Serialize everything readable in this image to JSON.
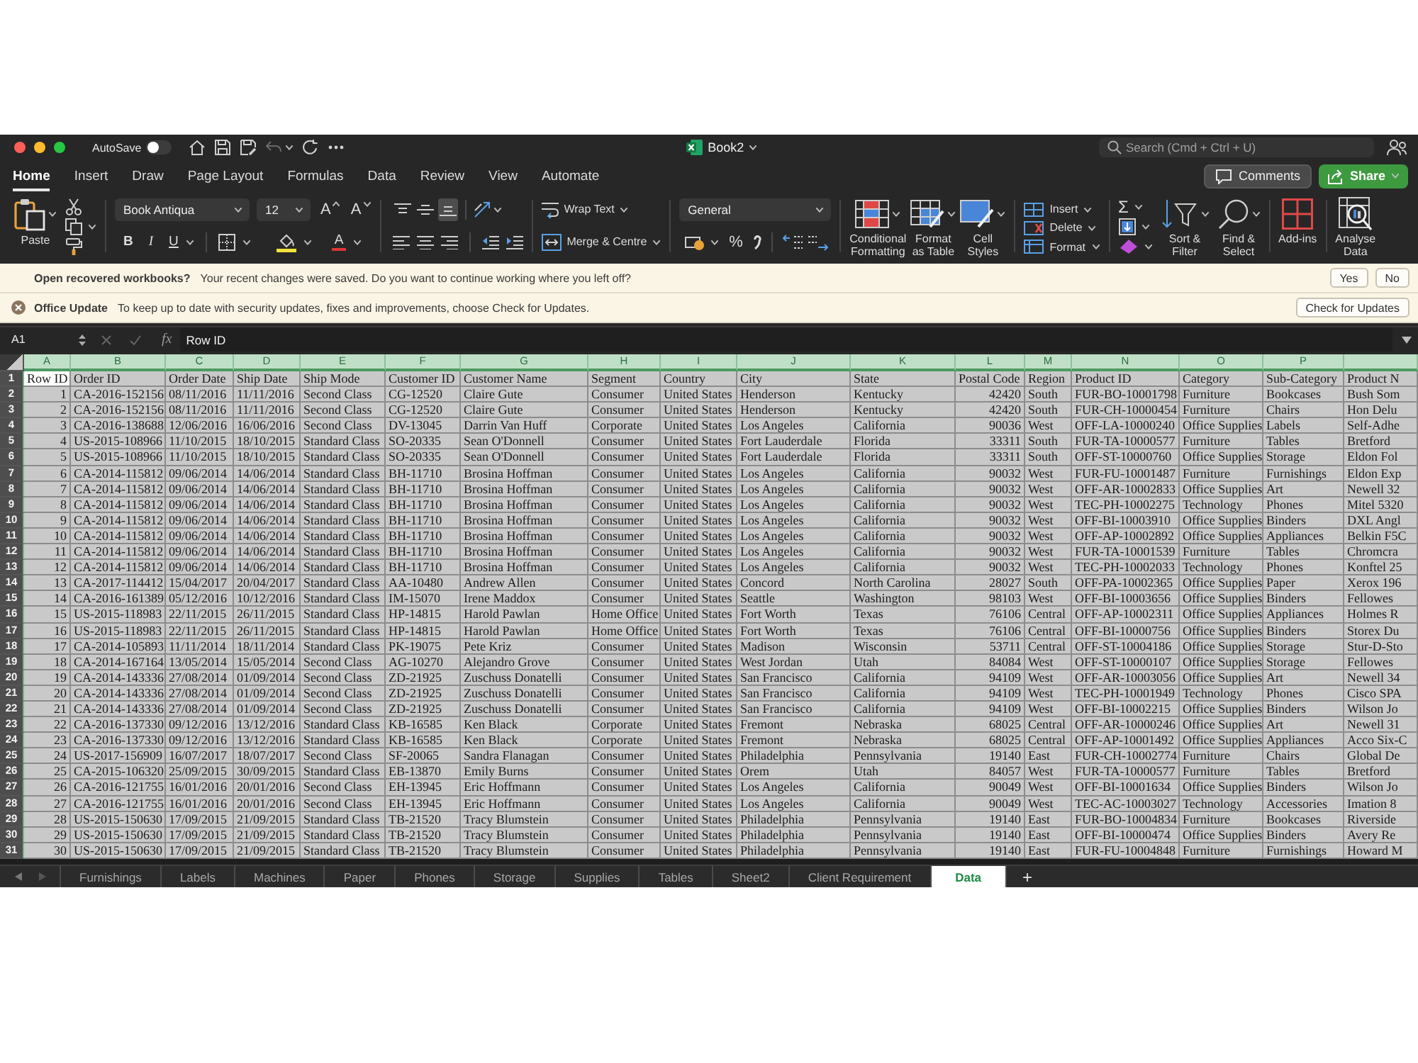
{
  "window": {
    "title": "Book2",
    "autosave": {
      "label": "AutoSave",
      "on": false
    },
    "search": {
      "placeholder": "Search (Cmd + Ctrl + U)"
    }
  },
  "ribbon_tabs": [
    {
      "label": "Home",
      "selected": true
    },
    {
      "label": "Insert",
      "selected": false
    },
    {
      "label": "Draw",
      "selected": false
    },
    {
      "label": "Page Layout",
      "selected": false
    },
    {
      "label": "Formulas",
      "selected": false
    },
    {
      "label": "Data",
      "selected": false
    },
    {
      "label": "Review",
      "selected": false
    },
    {
      "label": "View",
      "selected": false
    },
    {
      "label": "Automate",
      "selected": false
    }
  ],
  "actions": {
    "comments": "Comments",
    "share": "Share"
  },
  "ribbon": {
    "paste": "Paste",
    "font_name": "Book Antiqua",
    "font_size": "12",
    "grow_font": "A",
    "shrink_font": "A",
    "bold": "B",
    "italic": "I",
    "underline": "U",
    "font_color": "A",
    "vertical_align": [
      {
        "selected": false
      },
      {
        "selected": false
      },
      {
        "selected": true
      }
    ],
    "wrap_text": "Wrap Text",
    "merge": "Merge & Centre",
    "number_format": "General",
    "percent": "%",
    "styles": [
      "Conditional\nFormatting",
      "Format\nas Table",
      "Cell\nStyles"
    ],
    "cells": [
      "Insert",
      "Delete",
      "Format"
    ],
    "autosum": "Σ",
    "editing": [
      "Sort &\nFilter",
      "Find &\nSelect"
    ],
    "add_ins": "Add-ins",
    "analyse": "Analyse\nData"
  },
  "notices": [
    {
      "kind": "recovery",
      "title": "Open recovered workbooks?",
      "message": "Your recent changes were saved. Do you want to continue working where you left off?",
      "buttons": [
        "Yes",
        "No"
      ]
    },
    {
      "kind": "update",
      "title": "Office Update",
      "message": "To keep up to date with security updates, fixes and improvements, choose Check for Updates.",
      "buttons": [
        "Check for Updates"
      ]
    }
  ],
  "formula_bar": {
    "name_box": "A1",
    "fx": "fx",
    "formula": "Row ID"
  },
  "sheet": {
    "all_selected": true,
    "columns": [
      {
        "letter": "A",
        "numeric": true
      },
      {
        "letter": "B",
        "numeric": false
      },
      {
        "letter": "C",
        "numeric": false
      },
      {
        "letter": "D",
        "numeric": false
      },
      {
        "letter": "E",
        "numeric": false
      },
      {
        "letter": "F",
        "numeric": false
      },
      {
        "letter": "G",
        "numeric": false
      },
      {
        "letter": "H",
        "numeric": false
      },
      {
        "letter": "I",
        "numeric": false
      },
      {
        "letter": "J",
        "numeric": false
      },
      {
        "letter": "K",
        "numeric": false
      },
      {
        "letter": "L",
        "numeric": true
      },
      {
        "letter": "M",
        "numeric": false
      },
      {
        "letter": "N",
        "numeric": false
      },
      {
        "letter": "O",
        "numeric": false
      },
      {
        "letter": "P",
        "numeric": false
      },
      {
        "numeric": false
      }
    ],
    "header_row": {
      "number": "1",
      "cells": [
        {
          "text": "Row ID",
          "active": true
        },
        {
          "text": "Order ID",
          "active": false
        },
        {
          "text": "Order Date",
          "active": false
        },
        {
          "text": "Ship Date",
          "active": false
        },
        {
          "text": "Ship Mode",
          "active": false
        },
        {
          "text": "Customer ID",
          "active": false
        },
        {
          "text": "Customer Name",
          "active": false
        },
        {
          "text": "Segment",
          "active": false
        },
        {
          "text": "Country",
          "active": false
        },
        {
          "text": "City",
          "active": false
        },
        {
          "text": "State",
          "active": false
        },
        {
          "text": "Postal Code",
          "active": false
        },
        {
          "text": "Region",
          "active": false
        },
        {
          "text": "Product ID",
          "active": false
        },
        {
          "text": "Category",
          "active": false
        },
        {
          "text": "Sub-Category",
          "active": false
        },
        {
          "text": "Product N",
          "active": false
        }
      ]
    },
    "rows": [
      {
        "number": "2",
        "cells": [
          "1",
          "CA-2016-152156",
          "08/11/2016",
          "11/11/2016",
          "Second Class",
          "CG-12520",
          "Claire Gute",
          "Consumer",
          "United States",
          "Henderson",
          "Kentucky",
          "42420",
          "South",
          "FUR-BO-10001798",
          "Furniture",
          "Bookcases",
          "Bush Som"
        ]
      },
      {
        "number": "3",
        "cells": [
          "2",
          "CA-2016-152156",
          "08/11/2016",
          "11/11/2016",
          "Second Class",
          "CG-12520",
          "Claire Gute",
          "Consumer",
          "United States",
          "Henderson",
          "Kentucky",
          "42420",
          "South",
          "FUR-CH-10000454",
          "Furniture",
          "Chairs",
          "Hon Delu"
        ]
      },
      {
        "number": "4",
        "cells": [
          "3",
          "CA-2016-138688",
          "12/06/2016",
          "16/06/2016",
          "Second Class",
          "DV-13045",
          "Darrin Van Huff",
          "Corporate",
          "United States",
          "Los Angeles",
          "California",
          "90036",
          "West",
          "OFF-LA-10000240",
          "Office Supplies",
          "Labels",
          "Self-Adhe"
        ]
      },
      {
        "number": "5",
        "cells": [
          "4",
          "US-2015-108966",
          "11/10/2015",
          "18/10/2015",
          "Standard Class",
          "SO-20335",
          "Sean O'Donnell",
          "Consumer",
          "United States",
          "Fort Lauderdale",
          "Florida",
          "33311",
          "South",
          "FUR-TA-10000577",
          "Furniture",
          "Tables",
          "Bretford"
        ]
      },
      {
        "number": "6",
        "cells": [
          "5",
          "US-2015-108966",
          "11/10/2015",
          "18/10/2015",
          "Standard Class",
          "SO-20335",
          "Sean O'Donnell",
          "Consumer",
          "United States",
          "Fort Lauderdale",
          "Florida",
          "33311",
          "South",
          "OFF-ST-10000760",
          "Office Supplies",
          "Storage",
          "Eldon Fol"
        ]
      },
      {
        "number": "7",
        "cells": [
          "6",
          "CA-2014-115812",
          "09/06/2014",
          "14/06/2014",
          "Standard Class",
          "BH-11710",
          "Brosina Hoffman",
          "Consumer",
          "United States",
          "Los Angeles",
          "California",
          "90032",
          "West",
          "FUR-FU-10001487",
          "Furniture",
          "Furnishings",
          "Eldon Exp"
        ]
      },
      {
        "number": "8",
        "cells": [
          "7",
          "CA-2014-115812",
          "09/06/2014",
          "14/06/2014",
          "Standard Class",
          "BH-11710",
          "Brosina Hoffman",
          "Consumer",
          "United States",
          "Los Angeles",
          "California",
          "90032",
          "West",
          "OFF-AR-10002833",
          "Office Supplies",
          "Art",
          "Newell 32"
        ]
      },
      {
        "number": "9",
        "cells": [
          "8",
          "CA-2014-115812",
          "09/06/2014",
          "14/06/2014",
          "Standard Class",
          "BH-11710",
          "Brosina Hoffman",
          "Consumer",
          "United States",
          "Los Angeles",
          "California",
          "90032",
          "West",
          "TEC-PH-10002275",
          "Technology",
          "Phones",
          "Mitel 5320"
        ]
      },
      {
        "number": "10",
        "cells": [
          "9",
          "CA-2014-115812",
          "09/06/2014",
          "14/06/2014",
          "Standard Class",
          "BH-11710",
          "Brosina Hoffman",
          "Consumer",
          "United States",
          "Los Angeles",
          "California",
          "90032",
          "West",
          "OFF-BI-10003910",
          "Office Supplies",
          "Binders",
          "DXL Angl"
        ]
      },
      {
        "number": "11",
        "cells": [
          "10",
          "CA-2014-115812",
          "09/06/2014",
          "14/06/2014",
          "Standard Class",
          "BH-11710",
          "Brosina Hoffman",
          "Consumer",
          "United States",
          "Los Angeles",
          "California",
          "90032",
          "West",
          "OFF-AP-10002892",
          "Office Supplies",
          "Appliances",
          "Belkin F5C"
        ]
      },
      {
        "number": "12",
        "cells": [
          "11",
          "CA-2014-115812",
          "09/06/2014",
          "14/06/2014",
          "Standard Class",
          "BH-11710",
          "Brosina Hoffman",
          "Consumer",
          "United States",
          "Los Angeles",
          "California",
          "90032",
          "West",
          "FUR-TA-10001539",
          "Furniture",
          "Tables",
          "Chromcra"
        ]
      },
      {
        "number": "13",
        "cells": [
          "12",
          "CA-2014-115812",
          "09/06/2014",
          "14/06/2014",
          "Standard Class",
          "BH-11710",
          "Brosina Hoffman",
          "Consumer",
          "United States",
          "Los Angeles",
          "California",
          "90032",
          "West",
          "TEC-PH-10002033",
          "Technology",
          "Phones",
          "Konftel 25"
        ]
      },
      {
        "number": "14",
        "cells": [
          "13",
          "CA-2017-114412",
          "15/04/2017",
          "20/04/2017",
          "Standard Class",
          "AA-10480",
          "Andrew Allen",
          "Consumer",
          "United States",
          "Concord",
          "North Carolina",
          "28027",
          "South",
          "OFF-PA-10002365",
          "Office Supplies",
          "Paper",
          "Xerox 196"
        ]
      },
      {
        "number": "15",
        "cells": [
          "14",
          "CA-2016-161389",
          "05/12/2016",
          "10/12/2016",
          "Standard Class",
          "IM-15070",
          "Irene Maddox",
          "Consumer",
          "United States",
          "Seattle",
          "Washington",
          "98103",
          "West",
          "OFF-BI-10003656",
          "Office Supplies",
          "Binders",
          "Fellowes"
        ]
      },
      {
        "number": "16",
        "cells": [
          "15",
          "US-2015-118983",
          "22/11/2015",
          "26/11/2015",
          "Standard Class",
          "HP-14815",
          "Harold Pawlan",
          "Home Office",
          "United States",
          "Fort Worth",
          "Texas",
          "76106",
          "Central",
          "OFF-AP-10002311",
          "Office Supplies",
          "Appliances",
          "Holmes R"
        ]
      },
      {
        "number": "17",
        "cells": [
          "16",
          "US-2015-118983",
          "22/11/2015",
          "26/11/2015",
          "Standard Class",
          "HP-14815",
          "Harold Pawlan",
          "Home Office",
          "United States",
          "Fort Worth",
          "Texas",
          "76106",
          "Central",
          "OFF-BI-10000756",
          "Office Supplies",
          "Binders",
          "Storex Du"
        ]
      },
      {
        "number": "18",
        "cells": [
          "17",
          "CA-2014-105893",
          "11/11/2014",
          "18/11/2014",
          "Standard Class",
          "PK-19075",
          "Pete Kriz",
          "Consumer",
          "United States",
          "Madison",
          "Wisconsin",
          "53711",
          "Central",
          "OFF-ST-10004186",
          "Office Supplies",
          "Storage",
          "Stur-D-Sto"
        ]
      },
      {
        "number": "19",
        "cells": [
          "18",
          "CA-2014-167164",
          "13/05/2014",
          "15/05/2014",
          "Second Class",
          "AG-10270",
          "Alejandro Grove",
          "Consumer",
          "United States",
          "West Jordan",
          "Utah",
          "84084",
          "West",
          "OFF-ST-10000107",
          "Office Supplies",
          "Storage",
          "Fellowes"
        ]
      },
      {
        "number": "20",
        "cells": [
          "19",
          "CA-2014-143336",
          "27/08/2014",
          "01/09/2014",
          "Second Class",
          "ZD-21925",
          "Zuschuss Donatelli",
          "Consumer",
          "United States",
          "San Francisco",
          "California",
          "94109",
          "West",
          "OFF-AR-10003056",
          "Office Supplies",
          "Art",
          "Newell 34"
        ]
      },
      {
        "number": "21",
        "cells": [
          "20",
          "CA-2014-143336",
          "27/08/2014",
          "01/09/2014",
          "Second Class",
          "ZD-21925",
          "Zuschuss Donatelli",
          "Consumer",
          "United States",
          "San Francisco",
          "California",
          "94109",
          "West",
          "TEC-PH-10001949",
          "Technology",
          "Phones",
          "Cisco SPA"
        ]
      },
      {
        "number": "22",
        "cells": [
          "21",
          "CA-2014-143336",
          "27/08/2014",
          "01/09/2014",
          "Second Class",
          "ZD-21925",
          "Zuschuss Donatelli",
          "Consumer",
          "United States",
          "San Francisco",
          "California",
          "94109",
          "West",
          "OFF-BI-10002215",
          "Office Supplies",
          "Binders",
          "Wilson Jo"
        ]
      },
      {
        "number": "23",
        "cells": [
          "22",
          "CA-2016-137330",
          "09/12/2016",
          "13/12/2016",
          "Standard Class",
          "KB-16585",
          "Ken Black",
          "Corporate",
          "United States",
          "Fremont",
          "Nebraska",
          "68025",
          "Central",
          "OFF-AR-10000246",
          "Office Supplies",
          "Art",
          "Newell 31"
        ]
      },
      {
        "number": "24",
        "cells": [
          "23",
          "CA-2016-137330",
          "09/12/2016",
          "13/12/2016",
          "Standard Class",
          "KB-16585",
          "Ken Black",
          "Corporate",
          "United States",
          "Fremont",
          "Nebraska",
          "68025",
          "Central",
          "OFF-AP-10001492",
          "Office Supplies",
          "Appliances",
          "Acco Six-C"
        ]
      },
      {
        "number": "25",
        "cells": [
          "24",
          "US-2017-156909",
          "16/07/2017",
          "18/07/2017",
          "Second Class",
          "SF-20065",
          "Sandra Flanagan",
          "Consumer",
          "United States",
          "Philadelphia",
          "Pennsylvania",
          "19140",
          "East",
          "FUR-CH-10002774",
          "Furniture",
          "Chairs",
          "Global De"
        ]
      },
      {
        "number": "26",
        "cells": [
          "25",
          "CA-2015-106320",
          "25/09/2015",
          "30/09/2015",
          "Standard Class",
          "EB-13870",
          "Emily Burns",
          "Consumer",
          "United States",
          "Orem",
          "Utah",
          "84057",
          "West",
          "FUR-TA-10000577",
          "Furniture",
          "Tables",
          "Bretford"
        ]
      },
      {
        "number": "27",
        "cells": [
          "26",
          "CA-2016-121755",
          "16/01/2016",
          "20/01/2016",
          "Second Class",
          "EH-13945",
          "Eric Hoffmann",
          "Consumer",
          "United States",
          "Los Angeles",
          "California",
          "90049",
          "West",
          "OFF-BI-10001634",
          "Office Supplies",
          "Binders",
          "Wilson Jo"
        ]
      },
      {
        "number": "28",
        "cells": [
          "27",
          "CA-2016-121755",
          "16/01/2016",
          "20/01/2016",
          "Second Class",
          "EH-13945",
          "Eric Hoffmann",
          "Consumer",
          "United States",
          "Los Angeles",
          "California",
          "90049",
          "West",
          "TEC-AC-10003027",
          "Technology",
          "Accessories",
          "Imation 8"
        ]
      },
      {
        "number": "29",
        "cells": [
          "28",
          "US-2015-150630",
          "17/09/2015",
          "21/09/2015",
          "Standard Class",
          "TB-21520",
          "Tracy Blumstein",
          "Consumer",
          "United States",
          "Philadelphia",
          "Pennsylvania",
          "19140",
          "East",
          "FUR-BO-10004834",
          "Furniture",
          "Bookcases",
          "Riverside"
        ]
      },
      {
        "number": "30",
        "cells": [
          "29",
          "US-2015-150630",
          "17/09/2015",
          "21/09/2015",
          "Standard Class",
          "TB-21520",
          "Tracy Blumstein",
          "Consumer",
          "United States",
          "Philadelphia",
          "Pennsylvania",
          "19140",
          "East",
          "OFF-BI-10000474",
          "Office Supplies",
          "Binders",
          "Avery Re"
        ]
      },
      {
        "number": "31",
        "cells": [
          "30",
          "US-2015-150630",
          "17/09/2015",
          "21/09/2015",
          "Standard Class",
          "TB-21520",
          "Tracy Blumstein",
          "Consumer",
          "United States",
          "Philadelphia",
          "Pennsylvania",
          "19140",
          "East",
          "FUR-FU-10004848",
          "Furniture",
          "Furnishings",
          "Howard M"
        ]
      }
    ]
  },
  "sheet_tabs": [
    {
      "label": "Furnishings",
      "selected": false
    },
    {
      "label": "Labels",
      "selected": false
    },
    {
      "label": "Machines",
      "selected": false
    },
    {
      "label": "Paper",
      "selected": false
    },
    {
      "label": "Phones",
      "selected": false
    },
    {
      "label": "Storage",
      "selected": false
    },
    {
      "label": "Supplies",
      "selected": false
    },
    {
      "label": "Tables",
      "selected": false
    },
    {
      "label": "Sheet2",
      "selected": false
    },
    {
      "label": "Client Requirement",
      "selected": false
    },
    {
      "label": "Data",
      "selected": true
    }
  ],
  "add_sheet": "+"
}
